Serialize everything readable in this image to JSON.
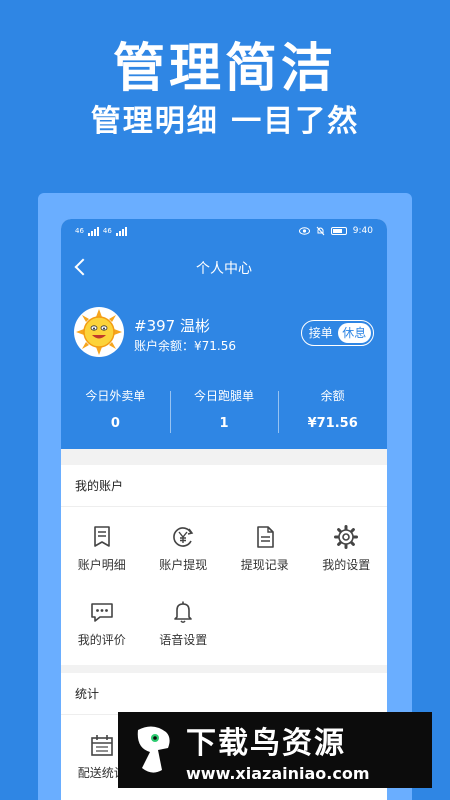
{
  "promo": {
    "title": "管理简洁",
    "subtitle": "管理明细 一目了然"
  },
  "statusbar": {
    "time": "9:40",
    "carrier1": "46",
    "carrier2": "46"
  },
  "nav": {
    "title": "个人中心"
  },
  "user": {
    "name": "#397 温彬",
    "balance_text": "账户余额：¥71.56"
  },
  "toggle": {
    "on_label": "接单",
    "off_label": "休息",
    "selected": "休息"
  },
  "stats": [
    {
      "label": "今日外卖单",
      "value": "0"
    },
    {
      "label": "今日跑腿单",
      "value": "1"
    },
    {
      "label": "余额",
      "value": "¥71.56"
    }
  ],
  "account": {
    "title": "我的账户",
    "items": [
      {
        "label": "账户明细",
        "icon": "document-list-icon"
      },
      {
        "label": "账户提现",
        "icon": "yen-withdraw-icon"
      },
      {
        "label": "提现记录",
        "icon": "record-file-icon"
      },
      {
        "label": "我的设置",
        "icon": "gear-icon"
      },
      {
        "label": "我的评价",
        "icon": "chat-bubble-icon"
      },
      {
        "label": "语音设置",
        "icon": "bell-icon"
      }
    ]
  },
  "stats_section": {
    "title": "统计",
    "items": [
      {
        "label": "配送统计",
        "icon": "calendar-icon"
      }
    ]
  },
  "watermark": {
    "brand": "下载鸟资源",
    "url": "www.xiazainiao.com"
  },
  "colors": {
    "primary": "#2f86e4",
    "frame": "#6aaeff",
    "background": "#f2f2f2"
  }
}
